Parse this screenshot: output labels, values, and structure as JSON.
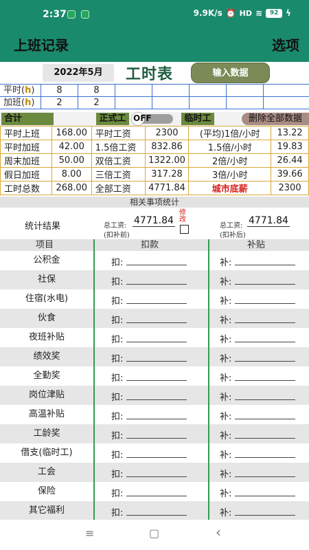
{
  "status": {
    "time": "2:37",
    "speed": "9.9K/s",
    "signal": "HD",
    "battery": "92"
  },
  "appbar": {
    "title": "上班记录",
    "options": "选项"
  },
  "header": {
    "month": "2022年5月",
    "title": "工时表",
    "input_button": "输入数据"
  },
  "hours": {
    "rows": [
      {
        "label_pre": "平时(",
        "label_h": "h",
        "label_post": ")",
        "cells": [
          "8",
          "8",
          "",
          "",
          "",
          "",
          "",
          ""
        ]
      },
      {
        "label_pre": "加班(",
        "label_h": "h",
        "label_post": ")",
        "cells": [
          "2",
          "2",
          "",
          "",
          "",
          "",
          "",
          ""
        ]
      }
    ]
  },
  "summary": {
    "label": "合计",
    "formal_tag": "正式工",
    "toggle_text": "OFF",
    "temp_tag": "临时工",
    "delete_button": "删除全部数据"
  },
  "calc": {
    "rows": [
      [
        "平时上班",
        "168.00",
        "平时工资",
        "2300",
        "(平均)1倍/小时",
        "13.22"
      ],
      [
        "平时加班",
        "42.00",
        "1.5倍工资",
        "832.86",
        "1.5倍/小时",
        "19.83"
      ],
      [
        "周末加班",
        "50.00",
        "双倍工资",
        "1322.00",
        "2倍/小时",
        "26.44"
      ],
      [
        "假日加班",
        "8.00",
        "三倍工资",
        "317.28",
        "3倍/小时",
        "39.66"
      ],
      [
        "工时总数",
        "268.00",
        "全部工资",
        "4771.84",
        "城市底薪",
        "2300"
      ]
    ]
  },
  "stats": {
    "heading": "相关事项统计",
    "result_label": "统计结果",
    "left_caption": "总工资:",
    "left_sub": "(扣补前)",
    "left_value": "4771.84",
    "modify": "修改",
    "right_caption": "总工资:",
    "right_sub": "(扣补后)",
    "right_value": "4771.84"
  },
  "columns": {
    "item": "项目",
    "deduct": "扣款",
    "subsidy": "补贴"
  },
  "prefix": {
    "deduct": "扣:",
    "subsidy": "补:"
  },
  "items": [
    "公积金",
    "社保",
    "住宿(水电)",
    "伙食",
    "夜班补贴",
    "绩效奖",
    "全勤奖",
    "岗位津贴",
    "高温补贴",
    "工龄奖",
    "借支(临时工)",
    "工会",
    "保险",
    "其它福利"
  ],
  "nav": {
    "menu": "≡",
    "home": "▢",
    "back": "‹"
  }
}
